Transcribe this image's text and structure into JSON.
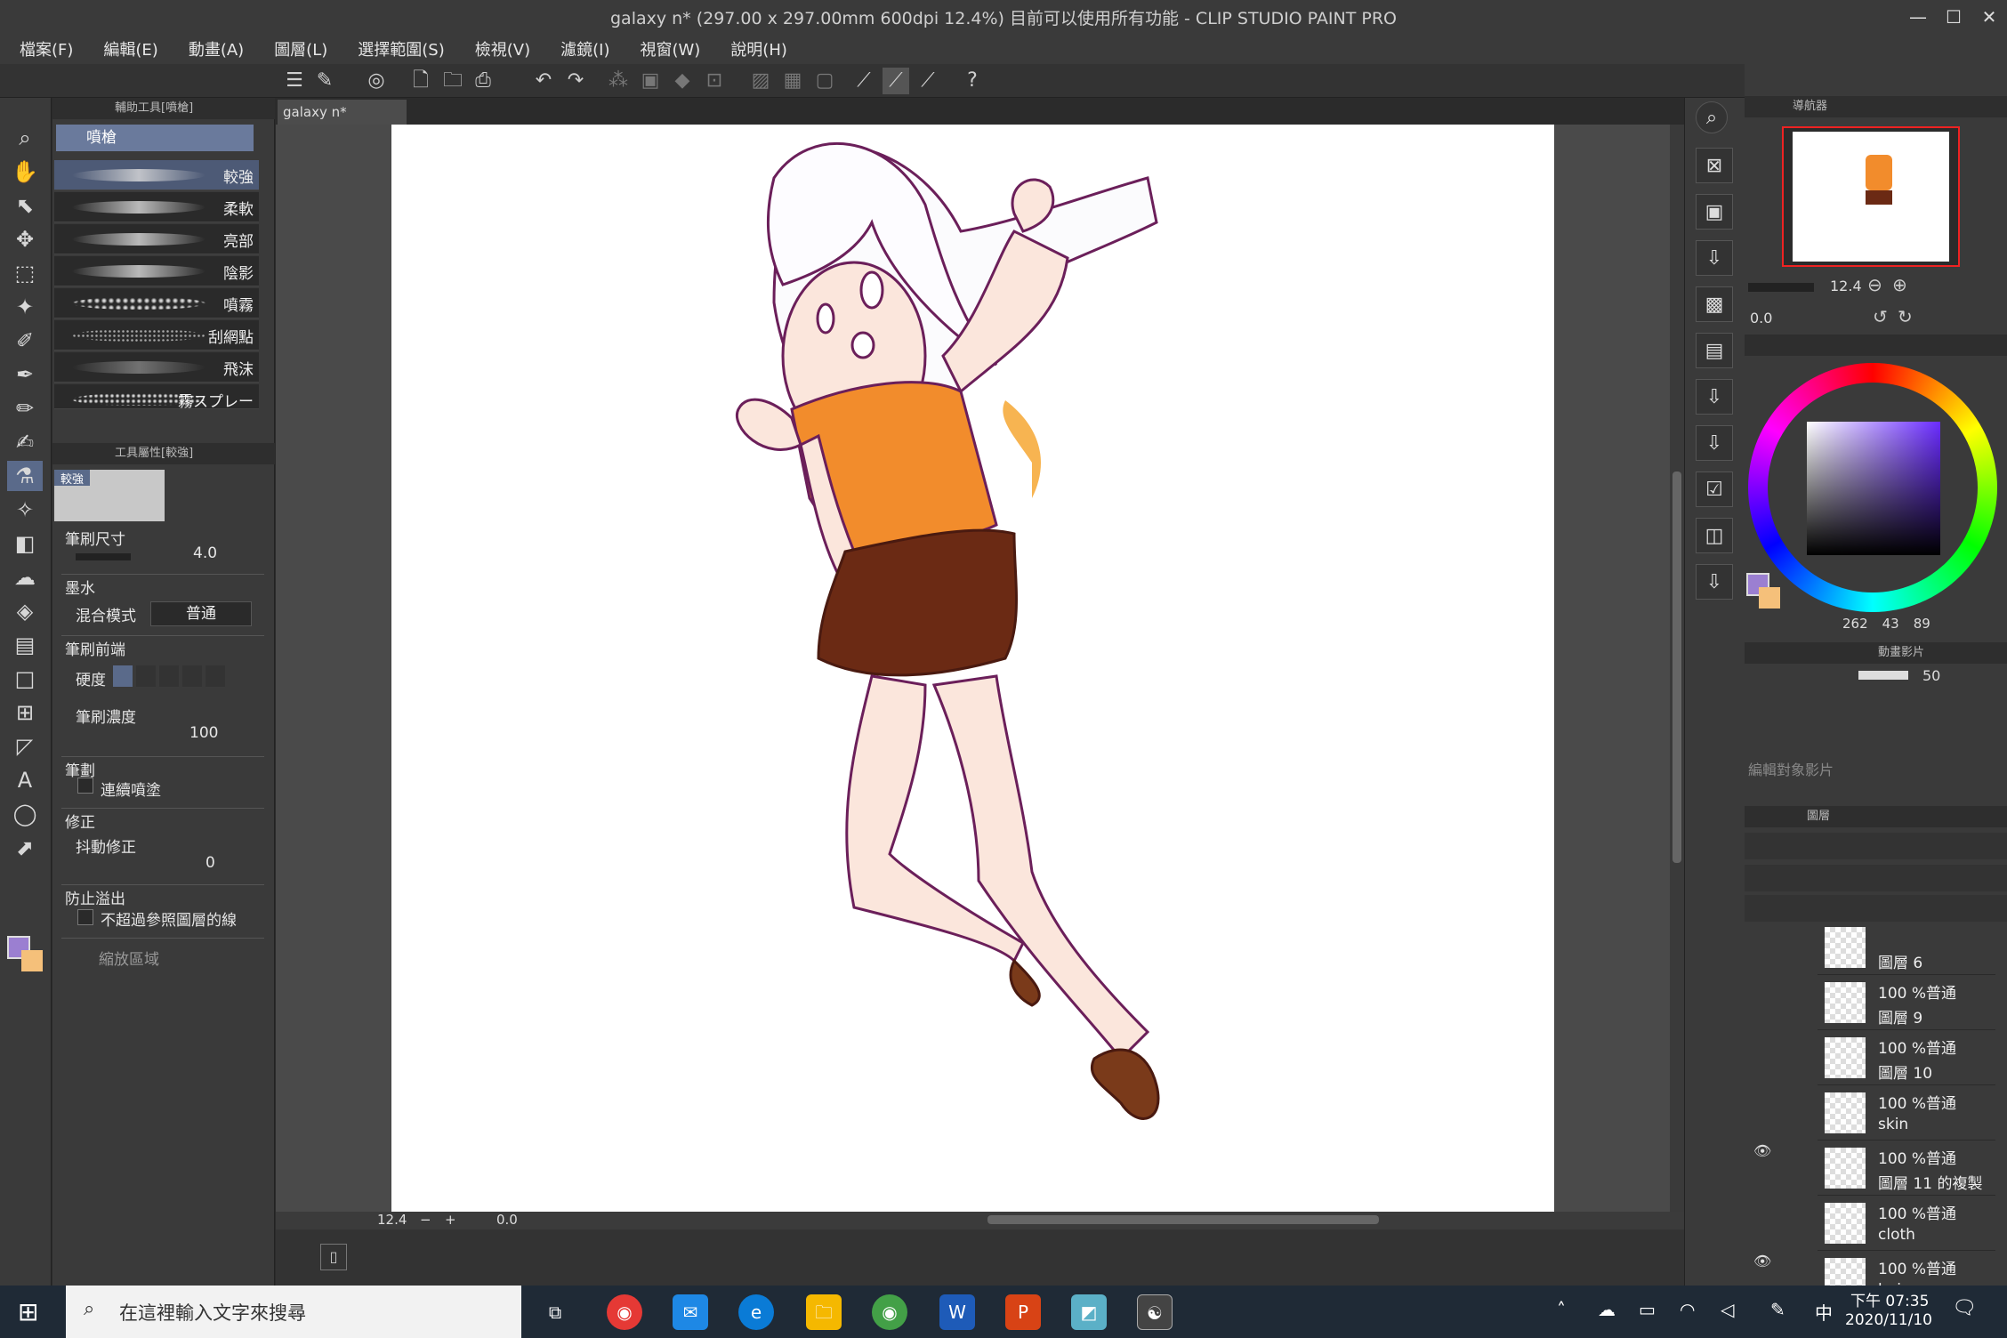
{
  "window": {
    "title": "galaxy n* (297.00 x 297.00mm 600dpi 12.4%)  目前可以使用所有功能 - CLIP STUDIO PAINT PRO",
    "controls": [
      "—",
      "☐",
      "✕"
    ]
  },
  "menu": [
    "檔案(F)",
    "編輯(E)",
    "動畫(A)",
    "圖層(L)",
    "選擇範圍(S)",
    "檢視(V)",
    "濾鏡(I)",
    "視窗(W)",
    "說明(H)"
  ],
  "subtool": {
    "header": "輔助工具[噴槍]",
    "group": "噴槍",
    "brushes": [
      "較強",
      "柔軟",
      "亮部",
      "陰影",
      "噴霧",
      "刮網點",
      "飛沫",
      "霧スプレー"
    ]
  },
  "toolprop": {
    "header": "工具屬性[較強]",
    "preview_label": "較強",
    "brush_size_label": "筆刷尺寸",
    "brush_size": "4.0",
    "ink_label": "墨水",
    "blend_label": "混合模式",
    "blend_value": "普通",
    "tip_label": "筆刷前端",
    "hardness_label": "硬度",
    "density_label": "筆刷濃度",
    "density": "100",
    "stroke_label": "筆劃",
    "continuous_label": "連續噴塗",
    "correction_label": "修正",
    "stabilize_label": "抖動修正",
    "stabilize": "0",
    "overflow_label": "防止溢出",
    "noref_label": "不超過參照圖層的線",
    "zoom_label": "縮放區域"
  },
  "document": {
    "tab": "galaxy n*"
  },
  "canvas_status": {
    "zoom": "12.4",
    "angle": "0.0"
  },
  "navigator": {
    "header": "導航器",
    "zoom": "12.4",
    "angle": "0.0"
  },
  "color": {
    "h": "262",
    "s": "43",
    "v": "89",
    "main": "#9b7fd1",
    "sub": "#f5c07a"
  },
  "animation": {
    "header": "動畫影片",
    "fps": "50",
    "edit_label": "編輯對象影片"
  },
  "layers": {
    "header": "圖層",
    "items": [
      {
        "opacity": "",
        "name": "圖層 6",
        "visible": false
      },
      {
        "opacity": "100 %普通",
        "name": "圖層 9",
        "visible": false
      },
      {
        "opacity": "100 %普通",
        "name": "圖層 10",
        "visible": false
      },
      {
        "opacity": "100 %普通",
        "name": "skin",
        "visible": true
      },
      {
        "opacity": "100 %普通",
        "name": "圖層 11 的複製",
        "visible": false
      },
      {
        "opacity": "100 %普通",
        "name": "cloth",
        "visible": true
      },
      {
        "opacity": "100 %普通",
        "name": "hair",
        "visible": false
      }
    ]
  },
  "taskbar": {
    "search_placeholder": "在這裡輸入文字來搜尋",
    "time": "下午 07:35",
    "date": "2020/11/10",
    "ime": "中"
  }
}
